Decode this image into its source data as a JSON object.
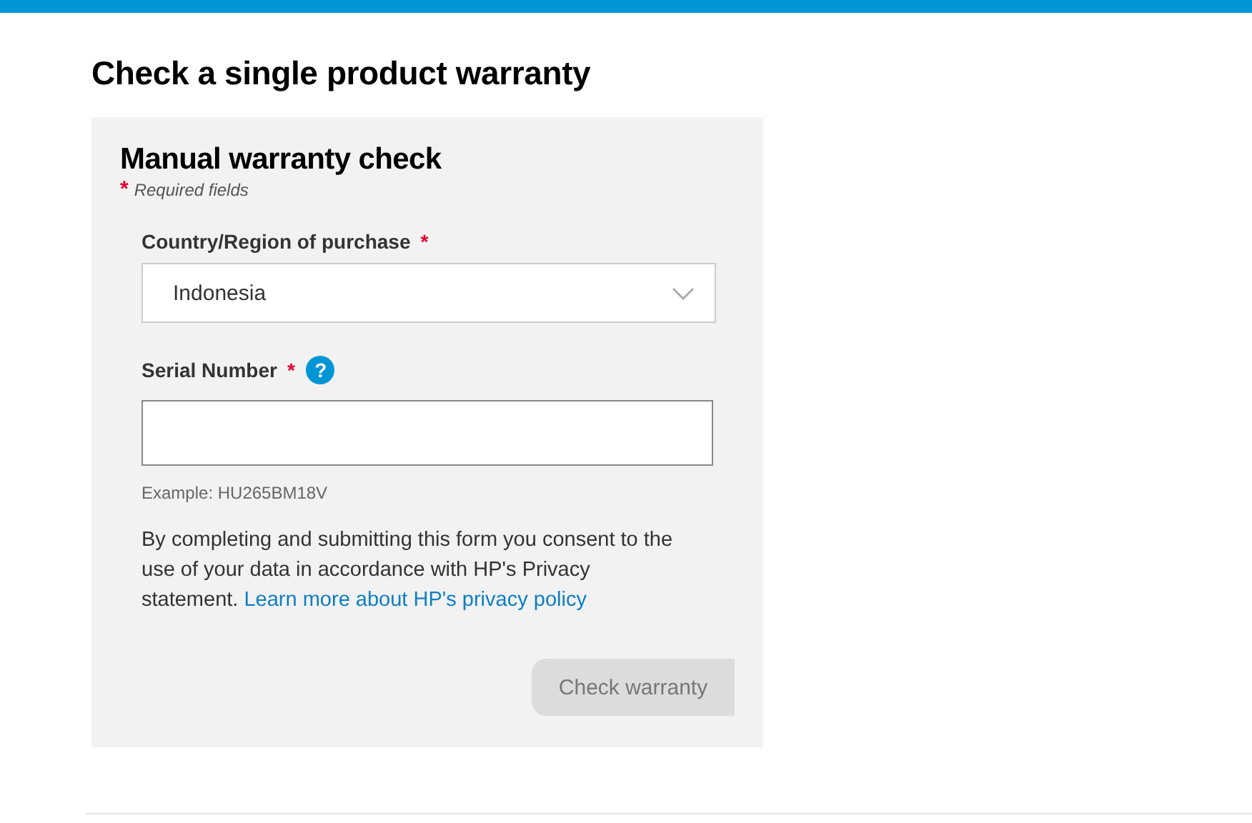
{
  "page_title": "Check a single product warranty",
  "form": {
    "title": "Manual warranty check",
    "required_note": {
      "mark": "*",
      "text": "Required fields"
    },
    "fields": [
      {
        "kind": "select",
        "label": "Country/Region of purchase",
        "required_mark": "*",
        "value": "Indonesia"
      },
      {
        "kind": "text",
        "label": "Serial Number",
        "required_mark": "*",
        "help": "?",
        "hint": "Example: HU265BM18V"
      }
    ],
    "consent": {
      "text": "By completing and submitting this form you consent to the use of your data in accordance with HP's Privacy statement.",
      "link": "Learn more about HP's privacy policy"
    },
    "submit": {
      "label": "Check warranty",
      "disabled": true
    }
  }
}
